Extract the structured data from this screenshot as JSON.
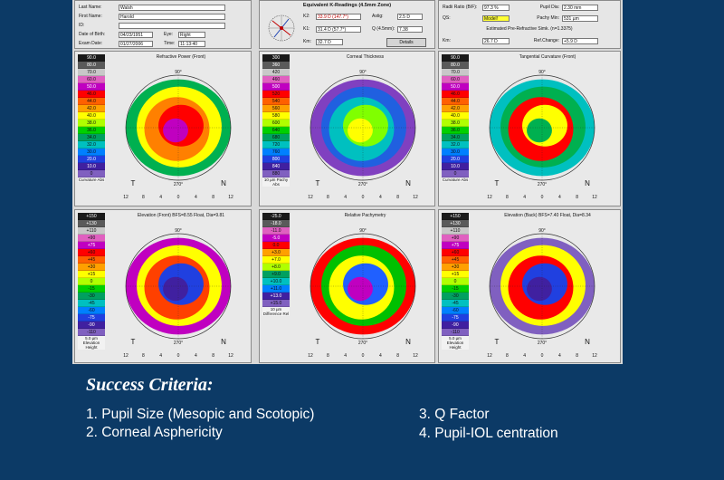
{
  "patient": {
    "last_name_label": "Last Name:",
    "last_name": "Walsh",
    "first_name_label": "First Name:",
    "first_name": "Harold",
    "id_label": "ID:",
    "id": "",
    "dob_label": "Date of Birth:",
    "dob": "04/23/1951",
    "eye_label": "Eye:",
    "eye": "Right",
    "exam_label": "Exam Date:",
    "exam": "01/27/2006",
    "time_label": "Time:",
    "time": "11:13:40"
  },
  "kreadings": {
    "title": "Equivalent K-Readings (4.5mm Zone)",
    "k2_label": "K2:",
    "k2": "33.9 D (147.7°)",
    "k1_label": "K1:",
    "k1": "31.4 D (57.7°)",
    "km_label": "Km:",
    "km": "32.7 D",
    "astig_label": "Astig:",
    "astig": "2.5 D",
    "q_label": "Q (4.5mm):",
    "q": "7.38",
    "details_label": "Details"
  },
  "radii": {
    "ratio_label": "Radii Ratio (B/F):",
    "ratio": "97.3 %",
    "pupil_label": "Pupil Dia:",
    "pupil": "2.30 mm",
    "qs_label": "QS:",
    "qs": "Model!",
    "pachy_label": "Pachy Min:",
    "pachy": "531 µm",
    "est_title": "Estimated Pre-Refractive Simk. (n=1.3375)",
    "km_label": "Km:",
    "km": "26.7 D",
    "refchange_label": "Ref.Change:",
    "refchange": "+5.9 D"
  },
  "maps": [
    {
      "title": "Refractive Power (Front)",
      "scale": [
        "90.0",
        "80.0",
        "70.0",
        "60.0",
        "50.0",
        "46.0",
        "44.0",
        "42.0",
        "40.0",
        "38.0",
        "36.0",
        "34.0",
        "32.0",
        "30.0",
        "20.0",
        "10.0",
        "0"
      ],
      "unit": "Curvature Abs"
    },
    {
      "title": "Corneal Thickness",
      "scale": [
        "300",
        "360",
        "420",
        "460",
        "500",
        "520",
        "540",
        "560",
        "580",
        "600",
        "640",
        "680",
        "720",
        "760",
        "800",
        "840",
        "880"
      ],
      "unit": "10 µm Pachy Abs"
    },
    {
      "title": "Tangential Curvature (Front)",
      "scale": [
        "90.0",
        "80.0",
        "70.0",
        "60.0",
        "50.0",
        "46.0",
        "44.0",
        "42.0",
        "40.0",
        "38.0",
        "36.0",
        "34.0",
        "32.0",
        "30.0",
        "20.0",
        "10.0",
        "0"
      ],
      "unit": "Curvature Abs"
    },
    {
      "title": "Elevation (Front) BFS=8.55 Float, Dia=9.81",
      "scale": [
        "+150",
        "+130",
        "+110",
        "+90",
        "+75",
        "+60",
        "+45",
        "+30",
        "+15",
        "0",
        "-15",
        "-30",
        "-45",
        "-60",
        "-75",
        "-90",
        "-110"
      ],
      "unit": "5.0 µm Elevation Height"
    },
    {
      "title": "Relative Pachymetry",
      "scale": [
        "-25.0",
        "-18.0",
        "-11.0",
        "-5.0",
        "0.0",
        "+3.0",
        "+7.0",
        "+8.0",
        "+9.0",
        "+10.0",
        "+11.0",
        "+13.0",
        "+15.0"
      ],
      "unit": "10 µm Difference Rel"
    },
    {
      "title": "Elevation (Back) BFS=7.40 Float, Dia=8.34",
      "scale": [
        "+150",
        "+130",
        "+110",
        "+90",
        "+75",
        "+60",
        "+45",
        "+30",
        "+15",
        "0",
        "-15",
        "-30",
        "-45",
        "-60",
        "-75",
        "-90",
        "-110"
      ],
      "unit": "5.0 µm Elevation Height"
    }
  ],
  "map_labels": {
    "top": "90°",
    "bottom": "270°",
    "left": "T",
    "right": "N",
    "axis": [
      "12",
      "8",
      "4",
      "0",
      "4",
      "8",
      "12"
    ]
  },
  "caption": {
    "title": "Success Criteria:",
    "items": [
      "1. Pupil Size (Mesopic and Scotopic)",
      "2. Corneal Asphericity",
      "3. Q Factor",
      "4. Pupil-IOL centration"
    ]
  },
  "colors": {
    "background": "#0c3a66",
    "text": "#ffffff"
  }
}
